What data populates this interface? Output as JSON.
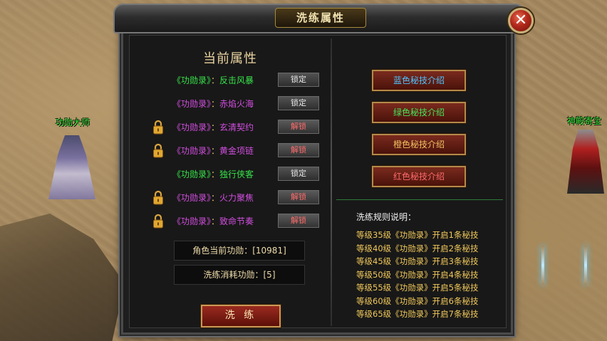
{
  "world": {
    "npc_left_name": "功勋大师",
    "npc_right_name": "神殿寄宝"
  },
  "dialog": {
    "title": "洗练属性",
    "close_symbol": "✕"
  },
  "left": {
    "title": "当前属性",
    "attributes": [
      {
        "prefix": "《功勋录》",
        "sep": "：",
        "name": "反击风暴",
        "quality": "green",
        "locked": false,
        "button": "锁定"
      },
      {
        "prefix": "《功勋录》",
        "sep": "：",
        "name": "赤焰火海",
        "quality": "purple",
        "locked": false,
        "button": "锁定"
      },
      {
        "prefix": "《功勋录》",
        "sep": "：",
        "name": "玄清契约",
        "quality": "purple",
        "locked": true,
        "button": "解锁"
      },
      {
        "prefix": "《功勋录》",
        "sep": "：",
        "name": "黄金项链",
        "quality": "purple",
        "locked": true,
        "button": "解锁"
      },
      {
        "prefix": "《功勋录》",
        "sep": "：",
        "name": "独行侠客",
        "quality": "green",
        "locked": false,
        "button": "锁定"
      },
      {
        "prefix": "《功勋录》",
        "sep": "：",
        "name": "火力聚焦",
        "quality": "purple",
        "locked": true,
        "button": "解锁"
      },
      {
        "prefix": "《功勋录》",
        "sep": "：",
        "name": "致命节奏",
        "quality": "purple",
        "locked": true,
        "button": "解锁"
      }
    ],
    "current_merit": "角色当前功勋：[10981]",
    "cost_merit": "洗练消耗功勋：[5]",
    "wash_button": "洗 练"
  },
  "right": {
    "skill_buttons": [
      {
        "label": "蓝色秘技介绍",
        "color": "#4fc3ff"
      },
      {
        "label": "绿色秘技介绍",
        "color": "#43e65a"
      },
      {
        "label": "橙色秘技介绍",
        "color": "#f0c060"
      },
      {
        "label": "红色秘技介绍",
        "color": "#ff6a6a"
      }
    ],
    "rules_title": "洗练规则说明：",
    "rules": [
      "等级35级《功勋录》开启1条秘技",
      "等级40级《功勋录》开启2条秘技",
      "等级45级《功勋录》开启3条秘技",
      "等级50级《功勋录》开启4条秘技",
      "等级55级《功勋录》开启5条秘技",
      "等级60级《功勋录》开启6条秘技",
      "等级65级《功勋录》开启7条秘技"
    ]
  },
  "colors": {
    "green_quality": "#37e34a",
    "purple_quality": "#d24ee0",
    "title_gold": "#e9d3a0",
    "rule_gold": "#f0c85a"
  }
}
